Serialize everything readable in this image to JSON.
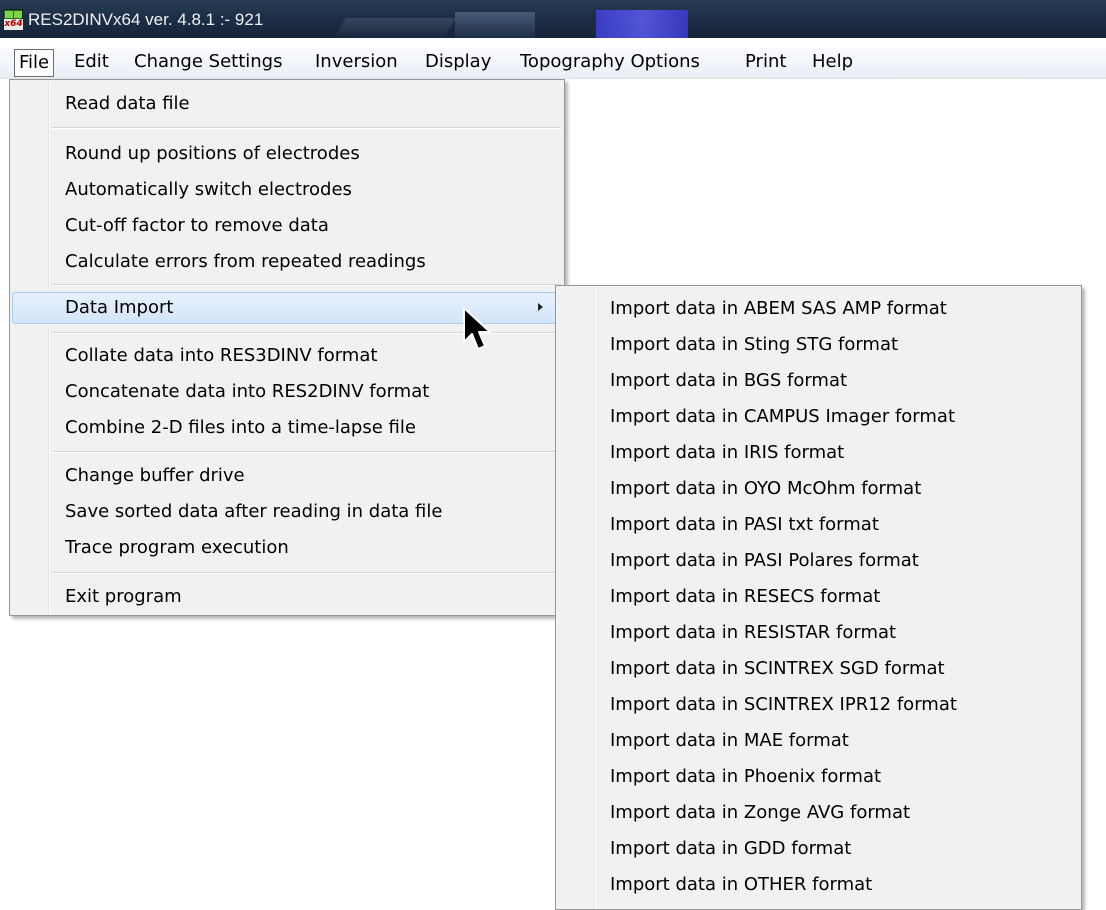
{
  "window": {
    "title": "RES2DINVx64 ver. 4.8.1 :- 921",
    "icon": "res2dinv-app-icon",
    "icon_text": "x64"
  },
  "menubar": [
    {
      "label": "File",
      "active": true
    },
    {
      "label": "Edit"
    },
    {
      "label": "Change Settings"
    },
    {
      "label": "Inversion"
    },
    {
      "label": "Display"
    },
    {
      "label": "Topography Options"
    },
    {
      "label": "Print"
    },
    {
      "label": "Help"
    }
  ],
  "file_menu": {
    "items": [
      "Read data file",
      "Round up positions of electrodes",
      "Automatically switch electrodes",
      "Cut-off factor to remove data",
      "Calculate errors from repeated readings",
      "Data Import",
      "Collate data into RES3DINV format",
      "Concatenate data into RES2DINV format",
      "Combine 2-D files into a time-lapse file",
      "Change buffer drive",
      "Save sorted data after reading in data file",
      "Trace program execution",
      "Exit program"
    ],
    "highlighted": "Data Import",
    "submenu_arrow_icon": "chevron-right-icon"
  },
  "data_import_submenu": {
    "items": [
      "Import data in ABEM SAS AMP format",
      "Import  data in Sting STG format",
      "Import data in BGS format",
      "Import data in CAMPUS Imager format",
      "Import data in IRIS format",
      "Import data in OYO McOhm format",
      "Import data in PASI txt format",
      "Import data in PASI Polares format",
      "Import data in RESECS format",
      "Import data in RESISTAR format",
      "Import data in SCINTREX SGD format",
      "Import data in SCINTREX IPR12 format",
      "Import data in MAE format",
      "Import data in Phoenix format",
      "Import data in Zonge AVG format",
      "Import data in GDD format",
      "Import data in OTHER format"
    ]
  },
  "colors": {
    "menu_bg": "#f1f1f1",
    "highlight": "#d2e5f9",
    "titlebar": "#1d2f47"
  }
}
